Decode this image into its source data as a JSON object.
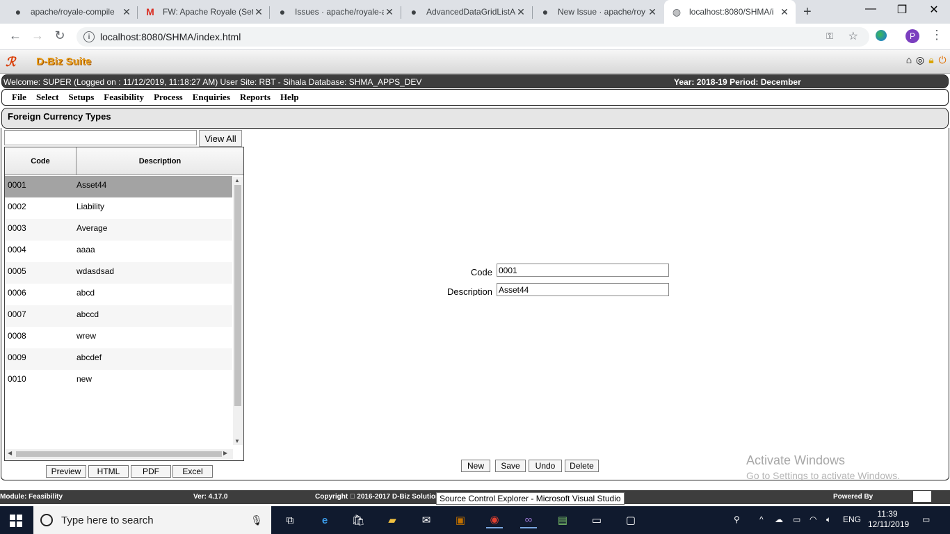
{
  "browser": {
    "tabs": [
      {
        "label": "apache/royale-compile",
        "icon": "github-icon"
      },
      {
        "label": "FW: Apache Royale (Set",
        "icon": "gmail-icon"
      },
      {
        "label": "Issues · apache/royale-a",
        "icon": "github-icon"
      },
      {
        "label": "AdvancedDataGridListA",
        "icon": "github-icon"
      },
      {
        "label": "New Issue · apache/roy",
        "icon": "github-icon"
      },
      {
        "label": "localhost:8080/SHMA/i",
        "icon": "globe-icon"
      }
    ],
    "url": "localhost:8080/SHMA/index.html",
    "profile_initial": "P"
  },
  "app": {
    "logo_text": "D-Biz Suite",
    "welcome_left": "Welcome: SUPER (Logged on : 11/12/2019, 11:18:27 AM) User Site: RBT - Sihala Database: SHMA_APPS_DEV",
    "welcome_right": "Year: 2018-19 Period: December",
    "menu": [
      "File",
      "Select",
      "Setups",
      "Feasibility",
      "Process",
      "Enquiries",
      "Reports",
      "Help"
    ],
    "page_title": "Foreign Currency Types",
    "search": {
      "value": "",
      "view_all_label": "View All"
    },
    "grid": {
      "columns": [
        "Code",
        "Description"
      ],
      "rows": [
        {
          "code": "0001",
          "description": "Asset44",
          "selected": true
        },
        {
          "code": "0002",
          "description": "Liability"
        },
        {
          "code": "0003",
          "description": "Average"
        },
        {
          "code": "0004",
          "description": "aaaa"
        },
        {
          "code": "0005",
          "description": "wdasdsad"
        },
        {
          "code": "0006",
          "description": "abcd"
        },
        {
          "code": "0007",
          "description": "abccd"
        },
        {
          "code": "0008",
          "description": "wrew"
        },
        {
          "code": "0009",
          "description": "abcdef"
        },
        {
          "code": "0010",
          "description": "new"
        }
      ]
    },
    "export_buttons": [
      "Preview",
      "HTML",
      "PDF",
      "Excel"
    ],
    "form": {
      "code_label": "Code",
      "code_value": "0001",
      "description_label": "Description",
      "description_value": "Asset44"
    },
    "actions": [
      "New",
      "Save",
      "Undo",
      "Delete"
    ],
    "status": {
      "module": "Module: Feasibility",
      "version": "Ver: 4.17.0",
      "copyright": "Copyright \u0000 2016-2017 D-Biz Solution",
      "powered_by": "Powered By"
    },
    "tooltip": "Source Control Explorer - Microsoft Visual Studio"
  },
  "windows": {
    "activate_title": "Activate Windows",
    "activate_sub": "Go to Settings to activate Windows.",
    "search_placeholder": "Type here to search",
    "language": "ENG",
    "time": "11:39",
    "date": "12/11/2019"
  }
}
